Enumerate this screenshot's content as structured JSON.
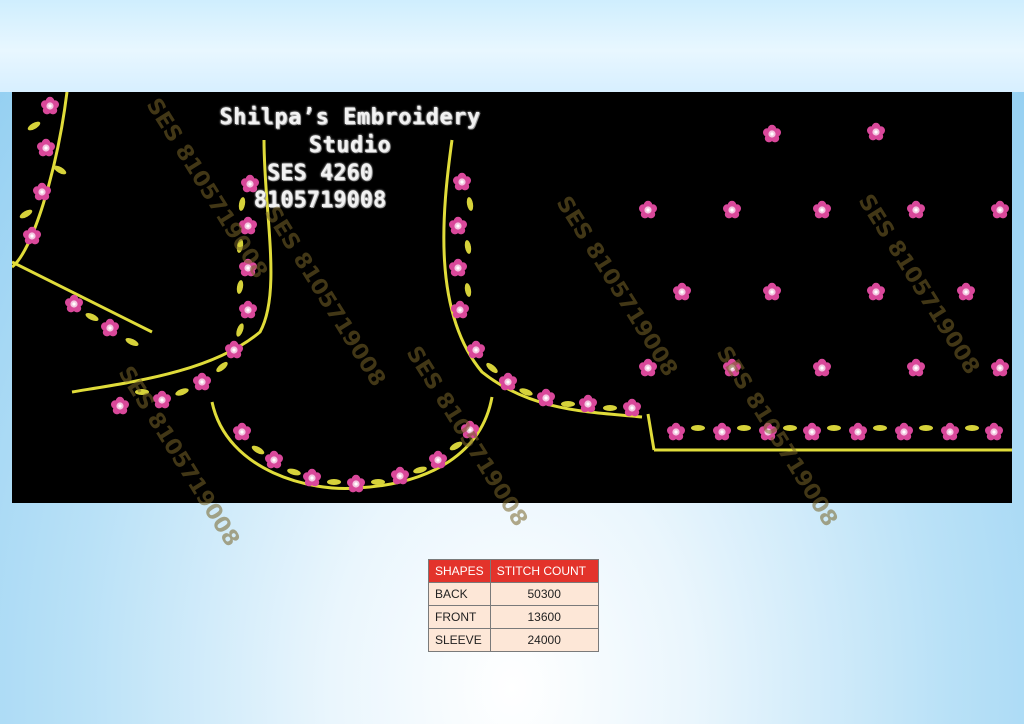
{
  "design": {
    "studio_name": "Shilpa’s Embroidery Studio",
    "design_code": "SES 4260",
    "phone": "8105719008",
    "watermark_text": "SES 8105719008"
  },
  "colors": {
    "background_panel": "#000000",
    "vine": "#e0dc3a",
    "flower": "#d9489a",
    "flower_center": "#f4c6e0",
    "table_header": "#e3332b",
    "table_cell": "#fde7d7"
  },
  "stitch_table": {
    "headers": [
      "SHAPES",
      "STITCH COUNT"
    ],
    "rows": [
      {
        "shape": "BACK",
        "count": "50300"
      },
      {
        "shape": "FRONT",
        "count": "13600"
      },
      {
        "shape": "SLEEVE",
        "count": "24000"
      }
    ]
  }
}
